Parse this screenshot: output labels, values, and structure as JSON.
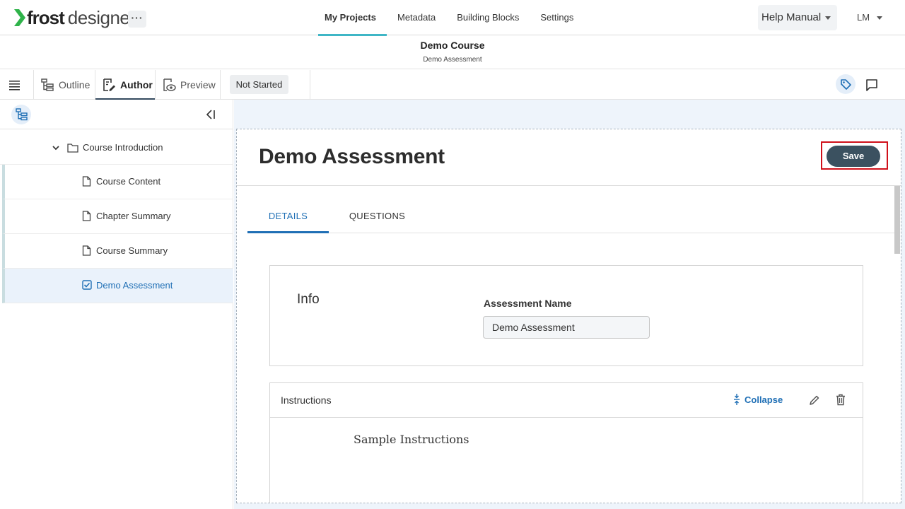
{
  "app": {
    "logo_bold": "frost",
    "logo_light": "designer",
    "more_label": "···",
    "nav": [
      "My Projects",
      "Metadata",
      "Building Blocks",
      "Settings"
    ],
    "help_label": "Help Manual",
    "user_initials": "LM",
    "accent_color": "#3fb6c6"
  },
  "course": {
    "title": "Demo Course",
    "subtitle": "Demo Assessment"
  },
  "toolbar": {
    "tabs": [
      "Outline",
      "Author",
      "Preview"
    ],
    "active_tab": "Author",
    "status": "Not Started"
  },
  "sidebar": {
    "folder": "Course Introduction",
    "items": [
      {
        "label": "Course Content",
        "icon": "page-icon"
      },
      {
        "label": "Chapter Summary",
        "icon": "page-icon"
      },
      {
        "label": "Course Summary",
        "icon": "page-icon"
      },
      {
        "label": "Demo Assessment",
        "icon": "checkbox-icon",
        "active": true
      }
    ]
  },
  "main": {
    "title": "Demo Assessment",
    "save_label": "Save",
    "tabs": [
      "DETAILS",
      "QUESTIONS"
    ],
    "active_tab": "DETAILS",
    "info": {
      "title": "Info",
      "field_label": "Assessment Name",
      "field_value": "Demo Assessment"
    },
    "instructions": {
      "title": "Instructions",
      "collapse_label": "Collapse",
      "body": "Sample Instructions"
    }
  }
}
